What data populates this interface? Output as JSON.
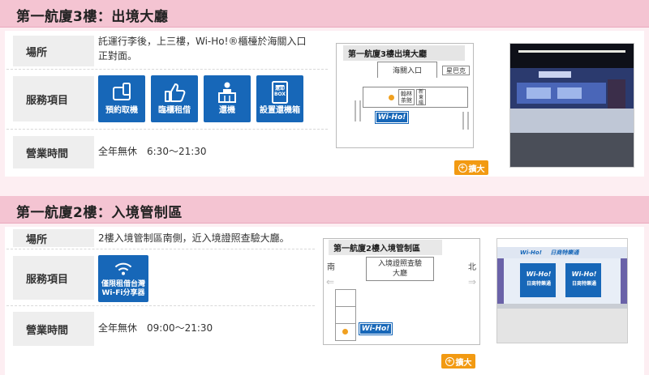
{
  "section1": {
    "title": "第一航廈3樓：出境大廳",
    "location_label": "場所",
    "location_text_line1": "託運行李後，上三樓，Wi-Ho!®櫃檯於海關入口",
    "location_text_line2": "正對面。",
    "services_label": "服務項目",
    "services": [
      {
        "label": "預約取機",
        "icon": "phone-pickup-icon"
      },
      {
        "label": "臨櫃租借",
        "icon": "thumbs-up-icon"
      },
      {
        "label": "還機",
        "icon": "counter-return-icon"
      },
      {
        "label": "設置還機箱",
        "icon": "return-box-icon",
        "box_text_line1": "還却",
        "box_text_line2": "BOX"
      }
    ],
    "hours_label": "營業時間",
    "hours_text": "全年無休　6:30～21:30",
    "map": {
      "title": "第一航廈3樓出境大廳",
      "gate_label": "海關入口",
      "shop_label": "星巴克",
      "counter_label_line1": "翰林",
      "counter_label_line2": "茶館",
      "side_label_line1": "新",
      "side_label_line2": "東陽",
      "logo": "Wi-Ho!"
    },
    "zoom_label": "擴大"
  },
  "section2": {
    "title": "第一航廈2樓：入境管制區",
    "location_label": "場所",
    "location_text": "2樓入境管制區南側，近入境證照查驗大廳。",
    "services_label": "服務項目",
    "services": [
      {
        "label_line1": "僅限租借台灣",
        "label_line2": "Wi-Fi分享器",
        "icon": "wifi-icon"
      }
    ],
    "hours_label": "營業時間",
    "hours_text": "全年無休　09:00～21:30",
    "map": {
      "title": "第一航廈2樓入境管制區",
      "south_label": "南",
      "north_label": "北",
      "hall_label_line1": "入境證照查驗",
      "hall_label_line2": "大廳",
      "logo": "Wi-Ho!"
    },
    "photo_signs": [
      "Wi-Ho!",
      "日商特樂通"
    ],
    "zoom_label": "擴大"
  },
  "colors": {
    "header_bg": "#f4c4d2",
    "service_blue": "#1767b8",
    "zoom_orange": "#f29a12",
    "label_bg": "#eeeeee"
  }
}
